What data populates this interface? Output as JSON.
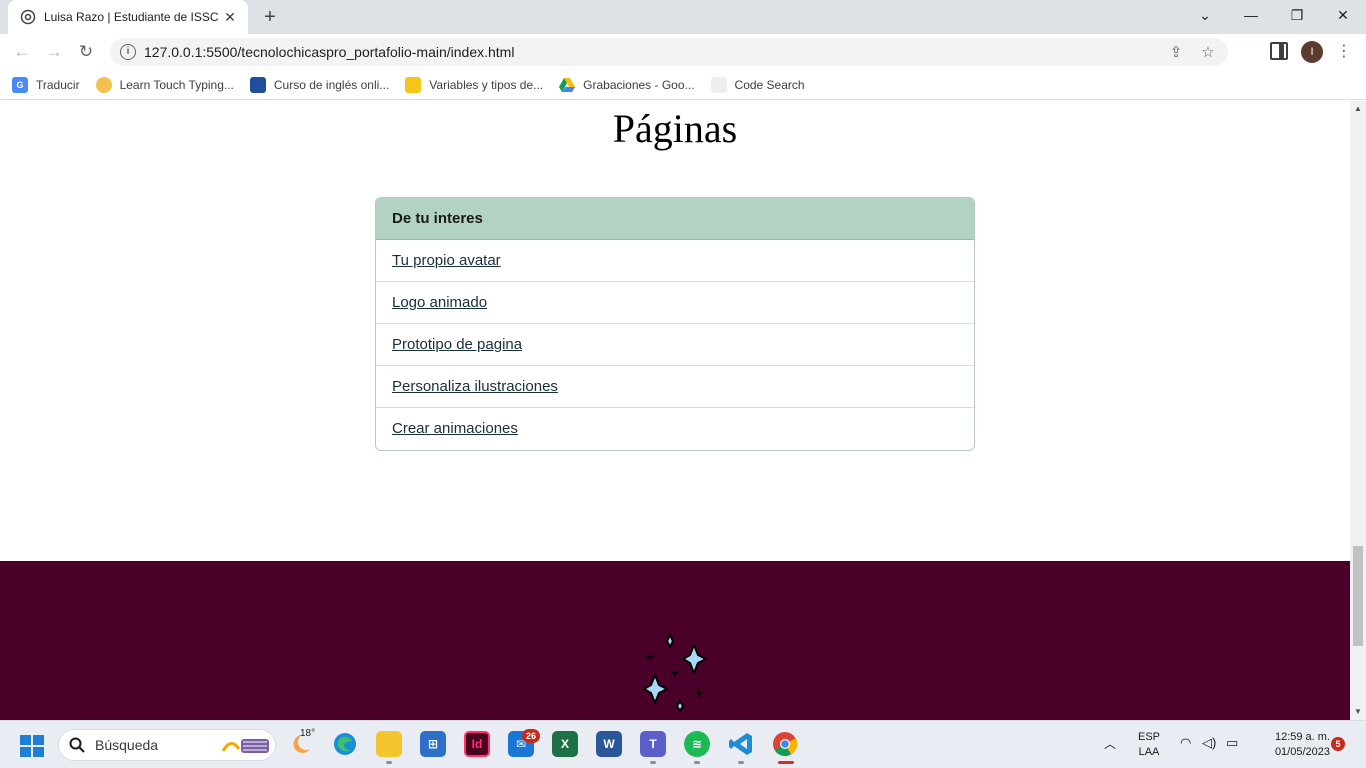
{
  "browser": {
    "tab_title": "Luisa Razo | Estudiante de ISSC",
    "new_tab_label": "+",
    "url": "127.0.0.1:5500/tecnolochicaspro_portafolio-main/index.html",
    "profile_initial": "I",
    "window_controls": {
      "collapse": "⌄",
      "minimize": "—",
      "restore": "❐",
      "close": "✕"
    },
    "nav": {
      "back": "←",
      "forward": "→",
      "reload": "↻"
    }
  },
  "bookmarks": [
    {
      "label": "Traducir",
      "icon": "google-translate-icon"
    },
    {
      "label": "Learn Touch Typing...",
      "icon": "typing-club-icon"
    },
    {
      "label": "Curso de inglés onli...",
      "icon": "english-course-icon"
    },
    {
      "label": "Variables y tipos de...",
      "icon": "folder-star-icon"
    },
    {
      "label": "Grabaciones - Goo...",
      "icon": "google-drive-icon"
    },
    {
      "label": "Code Search",
      "icon": "code-search-icon"
    }
  ],
  "page": {
    "heading": "Páginas",
    "card": {
      "header": "De tu interes",
      "links": [
        "Tu propio avatar",
        "Logo animado",
        "Prototipo de pagina",
        "Personaliza ilustraciones",
        "Crear animaciones"
      ]
    },
    "colors": {
      "card_header_bg": "#b3d3c2",
      "footer_bg": "#4b0029",
      "sparkle_fill": "#a9d8f5"
    }
  },
  "taskbar": {
    "search_placeholder": "Búsqueda",
    "weather_temp": "18°",
    "mail_badge": "26",
    "language_line1": "ESP",
    "language_line2": "LAA",
    "time": "12:59 a. m.",
    "date": "01/05/2023",
    "notification_count": "5",
    "apps": [
      "weather-icon",
      "edge-icon",
      "file-explorer-icon",
      "store-icon",
      "indesign-icon",
      "mail-icon",
      "excel-icon",
      "word-icon",
      "teams-icon",
      "spotify-icon",
      "vscode-icon",
      "chrome-icon"
    ]
  }
}
